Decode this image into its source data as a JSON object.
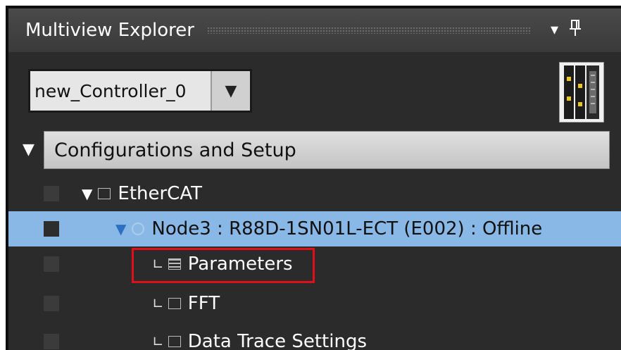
{
  "panel": {
    "title": "Multiview Explorer",
    "dropdown_icon": "chevron-down-icon",
    "pin_icon": "pin-icon"
  },
  "controller_select": {
    "value": "new_Controller_0"
  },
  "tree": {
    "section_label": "Configurations and Setup",
    "items": [
      {
        "label": "EtherCAT"
      },
      {
        "label": "Node3 : R88D-1SN01L-ECT (E002) : Offline",
        "selected": true
      },
      {
        "label": "Parameters",
        "highlighted": true
      },
      {
        "label": "FFT"
      },
      {
        "label": "Data Trace Settings"
      }
    ]
  },
  "colors": {
    "selection": "#8ab8e6",
    "highlight_border": "#e0101b"
  }
}
